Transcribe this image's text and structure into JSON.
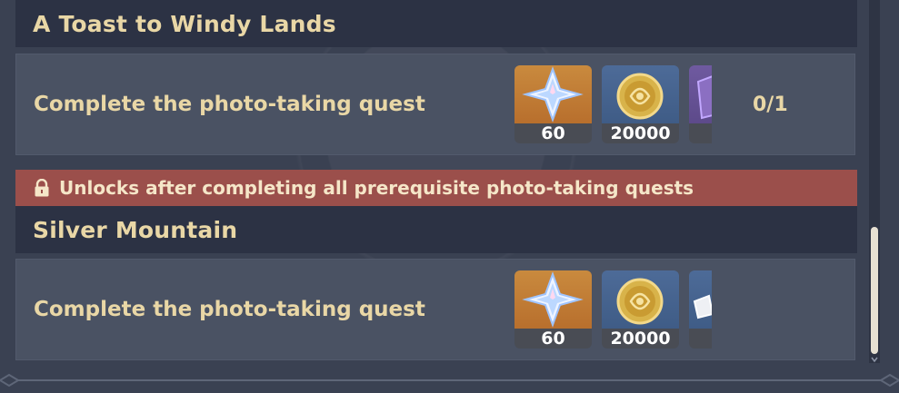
{
  "sections": [
    {
      "title": "A Toast to Windy Lands",
      "quest": {
        "label": "Complete the photo-taking quest",
        "progress": "0/1",
        "rewards": [
          {
            "icon": "primogem-icon",
            "count": "60"
          },
          {
            "icon": "mora-coin-icon",
            "count": "20000"
          },
          {
            "icon": "purple-book-icon",
            "count": ""
          }
        ]
      }
    },
    {
      "title": "Silver Mountain",
      "locked_message": "Unlocks after completing all prerequisite photo-taking quests",
      "quest": {
        "label": "Complete the photo-taking quest",
        "progress": "",
        "rewards": [
          {
            "icon": "primogem-icon",
            "count": "60"
          },
          {
            "icon": "mora-coin-icon",
            "count": "20000"
          },
          {
            "icon": "white-item-icon",
            "count": ""
          }
        ]
      }
    }
  ],
  "colors": {
    "background": "#3a4152",
    "header": "#2c3244",
    "row": "#4a5263",
    "text_gold": "#e9d7a6",
    "lock_banner": "#9b4f4b"
  }
}
